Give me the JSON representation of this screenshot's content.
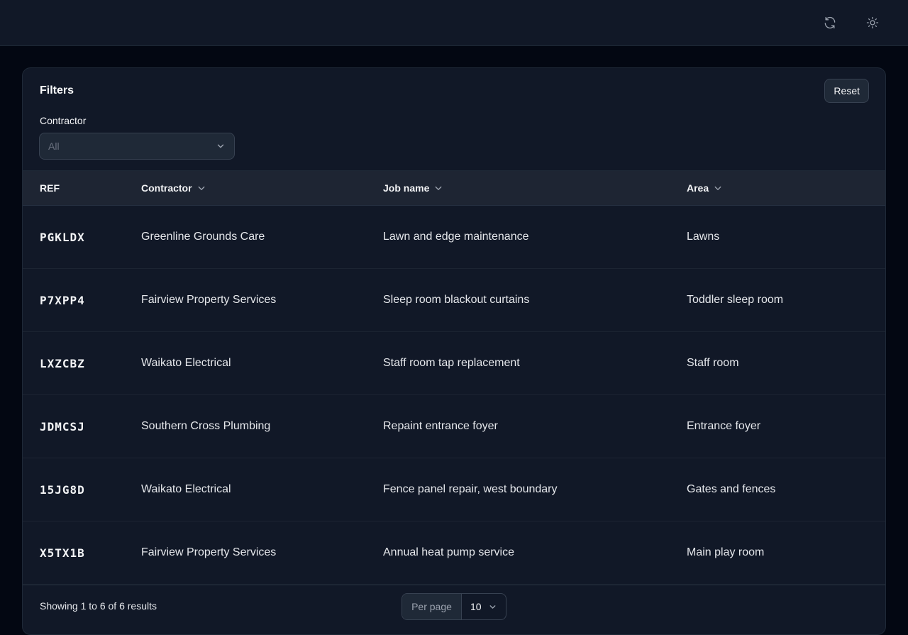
{
  "header": {
    "refresh_icon": "refresh-icon",
    "theme_icon": "sun-icon"
  },
  "filters": {
    "title": "Filters",
    "reset_label": "Reset",
    "contractor_label": "Contractor",
    "contractor_value": "All"
  },
  "table": {
    "columns": [
      "REF",
      "Contractor",
      "Job name",
      "Area"
    ],
    "rows": [
      {
        "ref": "PGKLDX",
        "contractor": "Greenline Grounds Care",
        "job": "Lawn and edge maintenance",
        "area": "Lawns"
      },
      {
        "ref": "P7XPP4",
        "contractor": "Fairview Property Services",
        "job": "Sleep room blackout curtains",
        "area": "Toddler sleep room"
      },
      {
        "ref": "LXZCBZ",
        "contractor": "Waikato Electrical",
        "job": "Staff room tap replacement",
        "area": "Staff room"
      },
      {
        "ref": "JDMCSJ",
        "contractor": "Southern Cross Plumbing",
        "job": "Repaint entrance foyer",
        "area": "Entrance foyer"
      },
      {
        "ref": "15JG8D",
        "contractor": "Waikato Electrical",
        "job": "Fence panel repair, west boundary",
        "area": "Gates and fences"
      },
      {
        "ref": "X5TX1B",
        "contractor": "Fairview Property Services",
        "job": "Annual heat pump service",
        "area": "Main play room"
      }
    ]
  },
  "footer": {
    "results_text": "Showing 1 to 6 of 6 results",
    "per_page_label": "Per page",
    "per_page_value": "10"
  }
}
